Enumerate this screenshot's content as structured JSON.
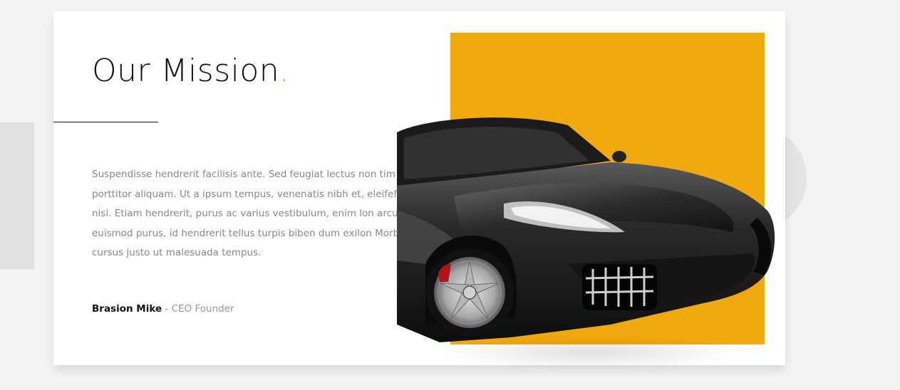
{
  "mission": {
    "title": "Our Mission",
    "title_dot": ".",
    "body": "Suspendisse hendrerit facilisis ante. Sed feugiat lectus non tim porttitor aliquam. Ut a ipsum tempus, venenatis nibh et, eleifefend nisi. Etiam hendrerit, purus ac varius vestibulum, enim lon arcu euismod purus, id hendrerit tellus turpis biben dum exilon Morbi cursus justo ut malesuada tempus.",
    "author_name": "Brasion Mike",
    "author_role": " - CEO Founder"
  },
  "colors": {
    "accent": "#f0a90e",
    "heading": "#111111",
    "body_text": "#888888"
  },
  "image": {
    "icon": "sports-car-image"
  }
}
